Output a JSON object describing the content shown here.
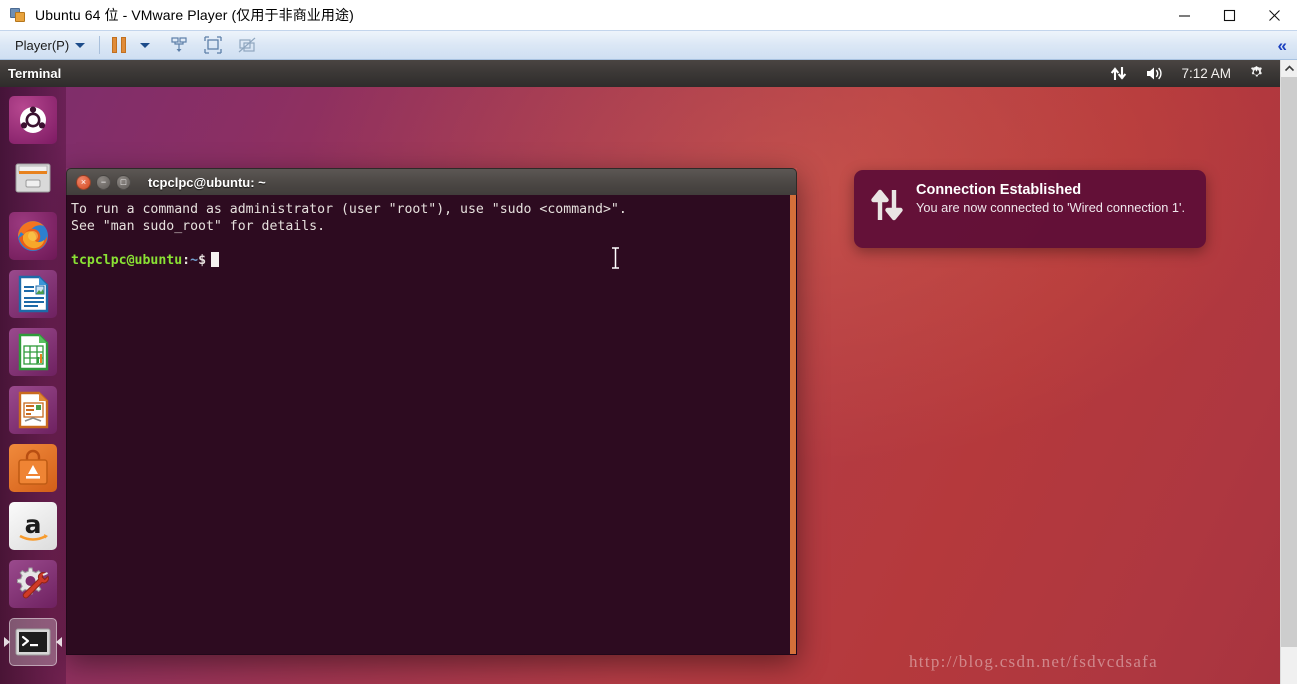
{
  "host": {
    "title": "Ubuntu 64 位 - VMware Player (仅用于非商业用途)",
    "window_controls": [
      {
        "name": "minimize",
        "glyph": "—"
      },
      {
        "name": "maximize",
        "glyph": "□"
      },
      {
        "name": "close",
        "glyph": "✕"
      }
    ]
  },
  "vmware_toolbar": {
    "player_menu_label": "Player(P)",
    "buttons": [
      {
        "name": "pause-vm",
        "label": "Pause"
      },
      {
        "name": "pause-dropdown",
        "label": "Pause options"
      },
      {
        "name": "send-ctrl-alt-del",
        "label": "Send Ctrl+Alt+Del"
      },
      {
        "name": "enter-fullscreen",
        "label": "Enter full screen"
      },
      {
        "name": "unity-mode",
        "label": "Unity mode"
      }
    ],
    "collapse_label": "«"
  },
  "ubuntu_panel": {
    "app_title": "Terminal",
    "clock": "7:12 AM",
    "indicators": [
      {
        "name": "network-icon",
        "label": "Network"
      },
      {
        "name": "volume-icon",
        "label": "Sound"
      },
      {
        "name": "session-gear-icon",
        "label": "System menu"
      }
    ]
  },
  "launcher": {
    "items": [
      {
        "name": "sidebar-item-dash",
        "label": "Ubuntu Dash Home",
        "icon": "ubuntu-dash-icon",
        "active": false
      },
      {
        "name": "sidebar-item-files",
        "label": "Files",
        "icon": "files-cabinet-icon",
        "active": false
      },
      {
        "name": "sidebar-item-firefox",
        "label": "Firefox Web Browser",
        "icon": "firefox-icon",
        "active": false
      },
      {
        "name": "sidebar-item-writer",
        "label": "LibreOffice Writer",
        "icon": "libreoffice-writer-icon",
        "active": false
      },
      {
        "name": "sidebar-item-calc",
        "label": "LibreOffice Calc",
        "icon": "libreoffice-calc-icon",
        "active": false
      },
      {
        "name": "sidebar-item-impress",
        "label": "LibreOffice Impress",
        "icon": "libreoffice-impress-icon",
        "active": false
      },
      {
        "name": "sidebar-item-software-center",
        "label": "Ubuntu Software Center",
        "icon": "software-center-bag-icon",
        "active": false
      },
      {
        "name": "sidebar-item-amazon",
        "label": "Amazon",
        "icon": "amazon-icon",
        "active": false
      },
      {
        "name": "sidebar-item-system-settings",
        "label": "System Settings",
        "icon": "gear-wrench-icon",
        "active": false
      },
      {
        "name": "sidebar-item-terminal",
        "label": "Terminal",
        "icon": "terminal-icon",
        "active": true
      }
    ]
  },
  "terminal": {
    "title": "tcpclpc@ubuntu: ~",
    "controls": {
      "close": "×",
      "minimize": "−",
      "maximize": "□"
    },
    "lines": [
      "To run a command as administrator (user \"root\"), use \"sudo <command>\".",
      "See \"man sudo_root\" for details."
    ],
    "prompt": {
      "user_host": "tcpclpc@ubuntu",
      "colon": ":",
      "path": "~",
      "dollar": "$"
    }
  },
  "notification": {
    "title": "Connection Established",
    "body": "You are now connected to 'Wired connection 1'.",
    "icon": "network-transfer-arrows-icon"
  },
  "watermark": {
    "text": "http://blog.csdn.net/fsdvcdsafa"
  },
  "colors": {
    "desktop_purple": "#7b2d6e",
    "desktop_red": "#a8343f",
    "terminal_bg": "#2d0b20",
    "terminal_green": "#8ae234",
    "terminal_blue": "#729fcf",
    "notification_bg": "#5c0d37",
    "ubuntu_orange": "#d4703a",
    "panel_bg": "#3b3836"
  }
}
